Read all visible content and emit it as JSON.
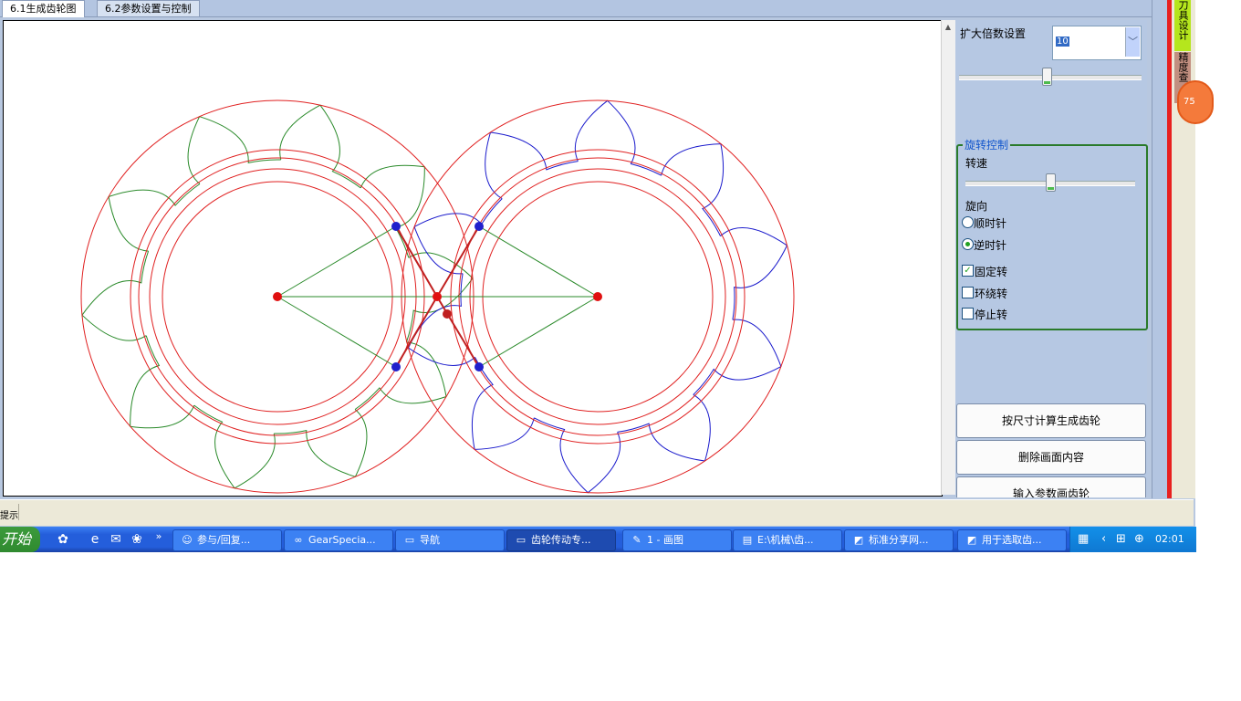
{
  "tabs": [
    {
      "label": "6.1生成齿轮图",
      "active": true
    },
    {
      "label": "6.2参数设置与控制",
      "active": false
    }
  ],
  "panel": {
    "zoom_label": "扩大倍数设置",
    "zoom_value": "10",
    "zoom_slider_level": 0.48,
    "group_title": "旋转控制",
    "speed_label": "转速",
    "speed_slider_level": 0.5,
    "direction_label": "旋向",
    "radio_cw": {
      "label": "顺时针",
      "checked": false
    },
    "radio_ccw": {
      "label": "逆时针",
      "checked": true
    },
    "check_fixed": {
      "label": "固定转",
      "checked": true
    },
    "check_orbit": {
      "label": "环绕转",
      "checked": false
    },
    "check_stop": {
      "label": "停止转",
      "checked": false
    },
    "buttons": [
      "按尺寸计算生成齿轮",
      "删除画面内容",
      "输入参数画齿轮"
    ]
  },
  "side_tabs": [
    "刀具设计",
    "精度查"
  ],
  "badge": "75",
  "status_text": "提示",
  "taskbar": {
    "start_label": "开始",
    "quick_launch": [
      "media-icon",
      "ie-icon",
      "outlook-icon",
      "flower-icon"
    ],
    "overflow": "»",
    "tasks": [
      {
        "icon": "☺",
        "label": "参与/回复...",
        "active": false
      },
      {
        "icon": "∞",
        "label": "GearSpecia...",
        "active": false
      },
      {
        "icon": "▭",
        "label": "导航",
        "active": false
      },
      {
        "icon": "▭",
        "label": "齿轮传动专...",
        "active": true
      },
      {
        "icon": "✎",
        "label": "1 - 画图",
        "active": false
      },
      {
        "icon": "▤",
        "label": "E:\\机械\\齿...",
        "active": false
      },
      {
        "icon": "◩",
        "label": "标准分享网...",
        "active": false
      },
      {
        "icon": "◩",
        "label": "用于选取齿...",
        "active": false
      }
    ],
    "clock": "02:01"
  },
  "colors": {
    "gear_circle": "#e02020",
    "gear1_teeth": "#2a8a2a",
    "gear2_teeth": "#1a1acc",
    "center_point": "#e01010",
    "contact_point": "#2020cc",
    "accent_red": "#e8201f"
  }
}
